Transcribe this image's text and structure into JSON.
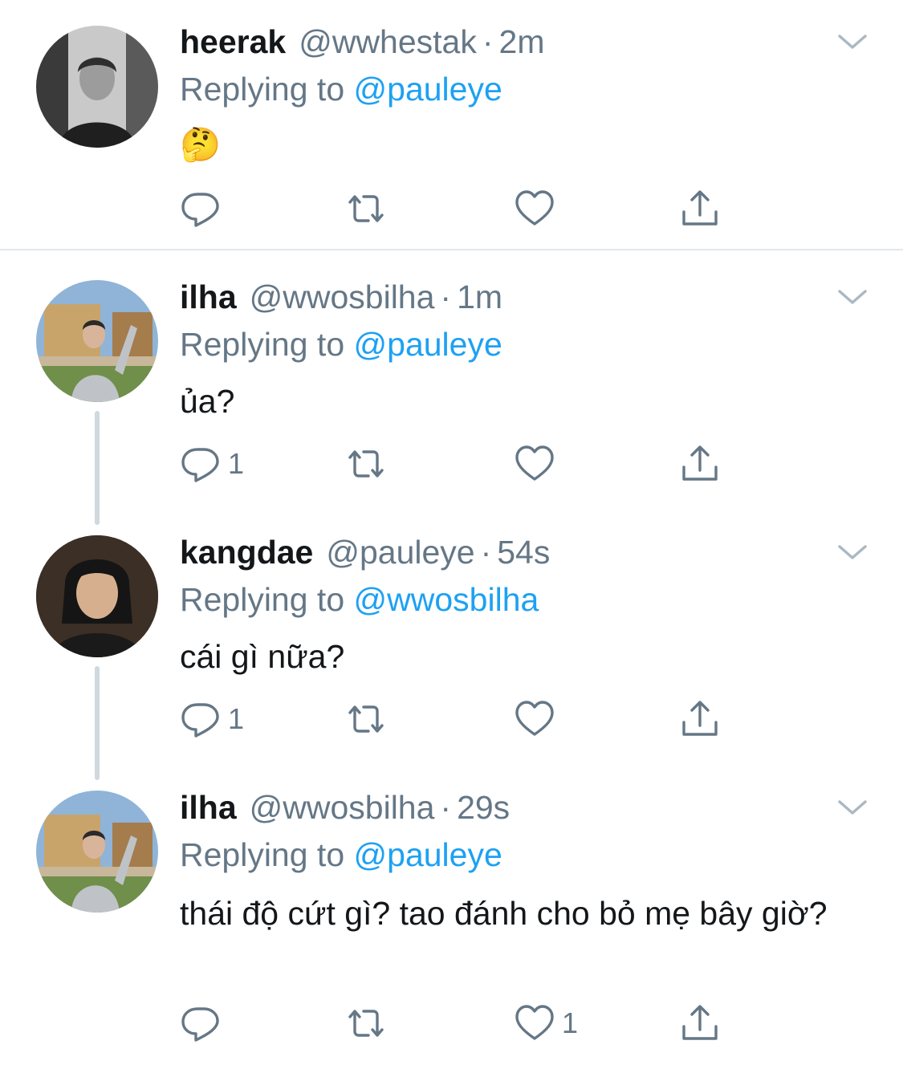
{
  "colors": {
    "text": "#14171a",
    "secondary": "#657786",
    "link": "#1da1f2",
    "divider": "#e1e8ed",
    "thread_line": "#cfd9de"
  },
  "icons": {
    "reply": "reply-icon",
    "retweet": "retweet-icon",
    "like": "heart-icon",
    "share": "share-icon",
    "menu": "chevron-down-icon"
  },
  "tweets": [
    {
      "name": "heerak",
      "handle": "@wwhestak",
      "separator": "·",
      "time": "2m",
      "replying_prefix": "Replying to",
      "replying_to": "@pauleye",
      "text": "🤔",
      "reply_count": "",
      "like_count": ""
    },
    {
      "name": "ilha",
      "handle": "@wwosbilha",
      "separator": "·",
      "time": "1m",
      "replying_prefix": "Replying to",
      "replying_to": "@pauleye",
      "text": "ủa?",
      "reply_count": "1",
      "like_count": ""
    },
    {
      "name": "kangdae",
      "handle": "@pauleye",
      "separator": "·",
      "time": "54s",
      "replying_prefix": "Replying to",
      "replying_to": "@wwosbilha",
      "text": "cái gì nữa?",
      "reply_count": "1",
      "like_count": ""
    },
    {
      "name": "ilha",
      "handle": "@wwosbilha",
      "separator": "·",
      "time": "29s",
      "replying_prefix": "Replying to",
      "replying_to": "@pauleye",
      "text": "thái độ cứt gì? tao đánh cho bỏ mẹ bây giờ?",
      "reply_count": "",
      "like_count": "1"
    }
  ]
}
